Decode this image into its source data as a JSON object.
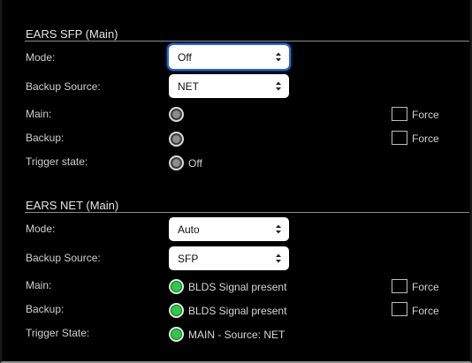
{
  "sfp": {
    "title": "EARS SFP (Main)",
    "mode_label": "Mode:",
    "mode_value": "Off",
    "backup_source_label": "Backup Source:",
    "backup_source_value": "NET",
    "main_label": "Main:",
    "backup_label": "Backup:",
    "trigger_label": "Trigger state:",
    "trigger_value": "Off",
    "force_main_label": "Force",
    "force_backup_label": "Force",
    "main_indicator": "gray",
    "backup_indicator": "gray",
    "trigger_indicator": "gray"
  },
  "net": {
    "title": "EARS NET (Main)",
    "mode_label": "Mode:",
    "mode_value": "Auto",
    "backup_source_label": "Backup Source:",
    "backup_source_value": "SFP",
    "main_label": "Main:",
    "main_status": "BLDS Signal present",
    "backup_label": "Backup:",
    "backup_status": "BLDS Signal present",
    "trigger_label": "Trigger State:",
    "trigger_value": "MAIN - Source: NET",
    "force_main_label": "Force",
    "force_backup_label": "Force",
    "main_indicator": "green",
    "backup_indicator": "green",
    "trigger_indicator": "green"
  },
  "colors": {
    "background": "#000000",
    "focus_ring": "#2f67c8",
    "indicator_green": "#2ec84a",
    "indicator_gray": "#8c8c8c"
  },
  "icons": {
    "select_arrows": "updown-chevron-icon",
    "indicator": "radio-indicator-icon"
  }
}
